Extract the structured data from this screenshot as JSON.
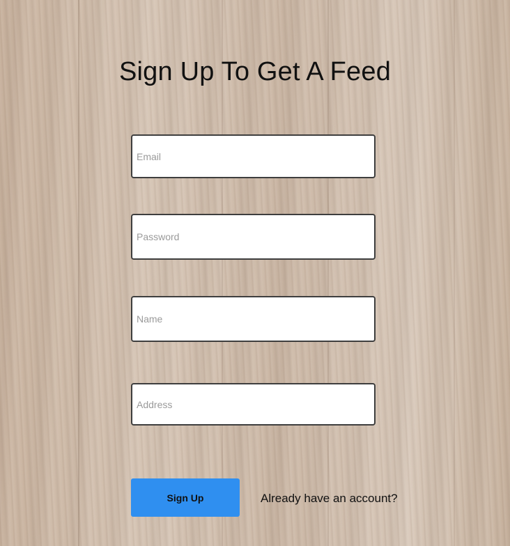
{
  "page": {
    "title": "Sign Up To Get A Feed"
  },
  "form": {
    "email": {
      "placeholder": "Email",
      "value": ""
    },
    "password": {
      "placeholder": "Password",
      "value": ""
    },
    "name": {
      "placeholder": "Name",
      "value": ""
    },
    "address": {
      "placeholder": "Address",
      "value": ""
    },
    "submit_label": "Sign Up",
    "login_link": "Already have an account?"
  },
  "colors": {
    "button": "#2f8ff0",
    "field_border": "#3e3e3e",
    "text": "#111111"
  }
}
